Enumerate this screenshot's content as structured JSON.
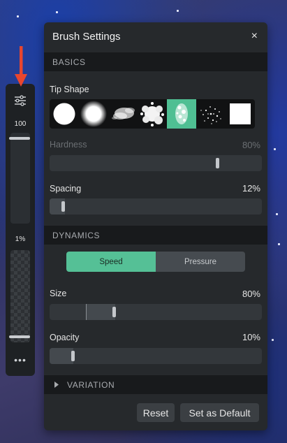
{
  "toolbar": {
    "size_value": "100",
    "opacity_value": "1%",
    "more_label": "•••"
  },
  "panel": {
    "title": "Brush Settings",
    "close_label": "×",
    "basics": {
      "header": "BASICS",
      "tip_shape_label": "Tip Shape",
      "tips": [
        "hard-round",
        "soft-round",
        "smoke",
        "splatter",
        "chalk",
        "spray",
        "square"
      ],
      "selected_tip": "chalk",
      "hardness_label": "Hardness",
      "hardness_value": "80%",
      "hardness_level": 0.8,
      "spacing_label": "Spacing",
      "spacing_value": "12%",
      "spacing_level": 0.06
    },
    "dynamics": {
      "header": "DYNAMICS",
      "tabs": [
        "Speed",
        "Pressure"
      ],
      "active_tab": "Speed",
      "size_label": "Size",
      "size_value": "80%",
      "opacity_label": "Opacity",
      "opacity_value": "10%"
    },
    "variation_header": "VARIATION",
    "reset_label": "Reset",
    "default_label": "Set as Default"
  },
  "colors": {
    "accent": "#55c096",
    "arrow": "#e8462e"
  }
}
